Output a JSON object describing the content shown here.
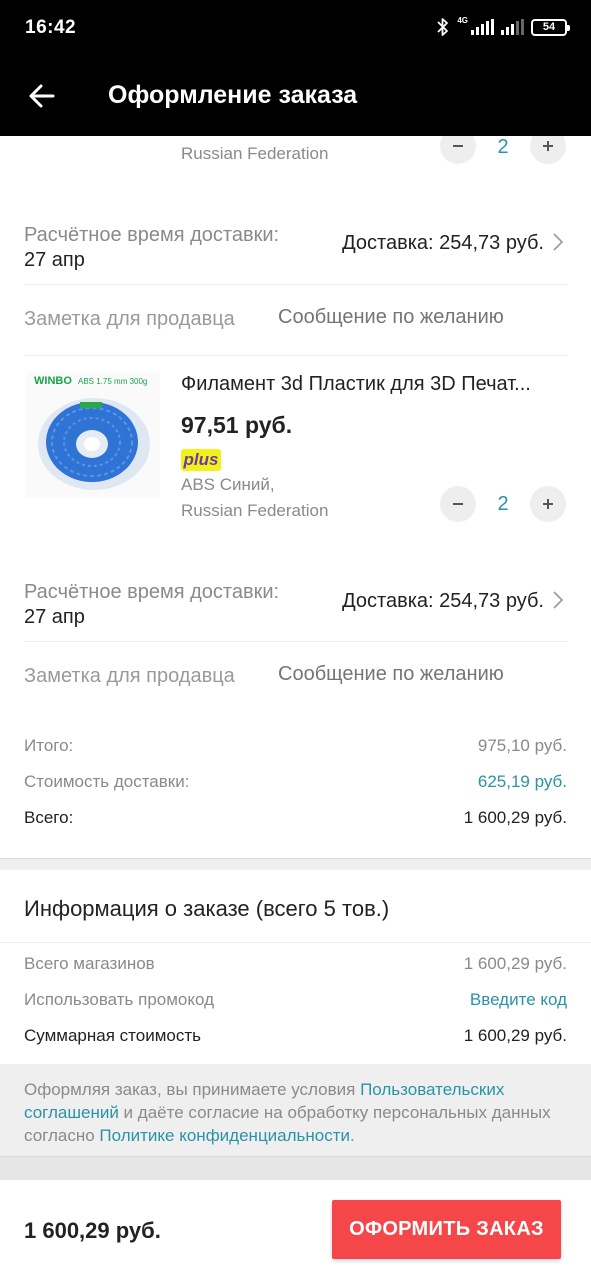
{
  "status_bar": {
    "time": "16:42",
    "network": "4G",
    "battery": "54",
    "icons": [
      "bluetooth-icon",
      "signal-icon",
      "signal-icon",
      "battery-icon"
    ]
  },
  "header": {
    "title": "Оформление заказа",
    "back_icon": "arrow-left-icon"
  },
  "items": [
    {
      "region": "Russian Federation",
      "quantity": "2",
      "delivery_label": "Расчётное время доставки:",
      "delivery_date": "27 апр",
      "delivery_cost": "Доставка: 254,73 руб.",
      "note_label": "Заметка для продавца",
      "note_placeholder": "Сообщение по желанию"
    },
    {
      "title": "Филамент 3d Пластик для 3D Печат...",
      "price": "97,51 руб.",
      "badge": "plus",
      "variant": "ABS Синий,",
      "region": "Russian Federation",
      "quantity": "2",
      "image_brand": "WINBO",
      "image_spec": "ABS 1.75 mm 300g",
      "delivery_label": "Расчётное время доставки:",
      "delivery_date": "27 апр",
      "delivery_cost": "Доставка: 254,73 руб.",
      "note_label": "Заметка для продавца",
      "note_placeholder": "Сообщение по желанию"
    }
  ],
  "store_summary": {
    "subtotal_label": "Итого:",
    "subtotal_value": "975,10 руб.",
    "shipping_label": "Стоимость доставки:",
    "shipping_value": "625,19 руб.",
    "total_label": "Всего:",
    "total_value": "1 600,29 руб."
  },
  "order_info": {
    "title": "Информация о заказе (всего 5 тов.)",
    "stores_label": "Всего магазинов",
    "stores_value": "1 600,29 руб.",
    "promo_label": "Использовать промокод",
    "promo_link": "Введите код",
    "sum_label": "Суммарная стоимость",
    "sum_value": "1 600,29 руб."
  },
  "legal": {
    "part1": "Оформляя заказ, вы принимаете условия ",
    "link1": "Пользовательских соглашений",
    "part2": " и даёте согласие на обработку персональных данных согласно ",
    "link2": "Политике конфиденциальности",
    "part3": "."
  },
  "bottom": {
    "total": "1 600,29 руб.",
    "button": "ОФОРМИТЬ ЗАКАЗ"
  },
  "colors": {
    "accent": "#2a93a8",
    "button": "#f5474a",
    "plus_badge": "#f2f21a",
    "header_bg": "#000000"
  }
}
